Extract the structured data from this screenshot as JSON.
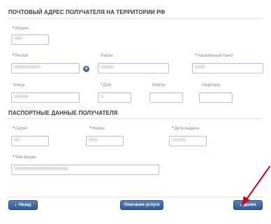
{
  "address": {
    "title": "ПОЧТОВЫЙ АДРЕС ПОЛУЧАТЕЛЯ НА ТЕРРИТОРИИ РФ",
    "index": {
      "label": "Индекс",
      "required": "*",
      "value": "••••••"
    },
    "region": {
      "label": "Регион",
      "required": "*",
      "value": "••••••••••••••••••"
    },
    "district": {
      "label": "Район",
      "required": "",
      "value": "•••••••••"
    },
    "locality": {
      "label": "Населённый пункт",
      "required": "*",
      "value": "•••••••"
    },
    "street": {
      "label": "Улица",
      "required": "",
      "value": "••••••••••"
    },
    "house": {
      "label": "Дом",
      "required": "*",
      "value": "••"
    },
    "building": {
      "label": "Корпус",
      "required": "",
      "value": ""
    },
    "flat": {
      "label": "Квартира",
      "required": "",
      "value": ""
    },
    "clear_symbol": "×"
  },
  "passport": {
    "title": "ПАСПОРТНЫЕ ДАННЫЕ ПОЛУЧАТЕЛЯ",
    "series": {
      "label": "Серия",
      "required": "*",
      "value": "••••"
    },
    "number": {
      "label": "Номер",
      "required": "*",
      "value": "••••••"
    },
    "issue_date": {
      "label": "Дата выдачи",
      "required": "*",
      "value": "••.••.••••"
    },
    "issued_by": {
      "label": "Кем выдан",
      "required": "*",
      "value": "•••••••••••••••••••••••••••••••••••••"
    }
  },
  "buttons": {
    "back": {
      "label": "Назад",
      "icon": "chevron-left-icon",
      "glyph": "‹"
    },
    "service": {
      "label": "Описание услуги"
    },
    "next": {
      "label": "Далее",
      "icon": "chevron-right-icon",
      "glyph": "›"
    }
  },
  "colors": {
    "accent": "#2f5a94",
    "required": "#d0021b",
    "annotation_arrow": "#d0021b"
  }
}
